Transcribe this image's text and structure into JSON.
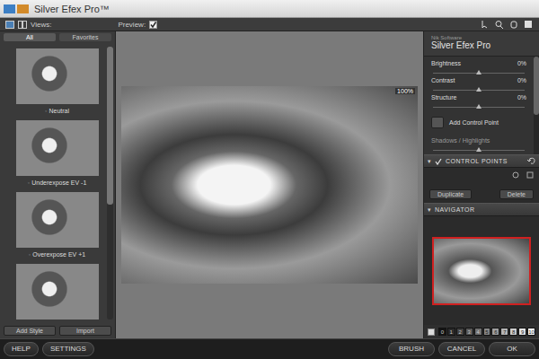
{
  "window": {
    "title": "Silver Efex Pro™"
  },
  "toolbar": {
    "views_label": "Views:",
    "preview_label": "Preview:",
    "preview_checked": true
  },
  "styles_panel": {
    "tabs": [
      {
        "label": "All",
        "selected": true
      },
      {
        "label": "Favorites",
        "selected": false
      }
    ],
    "styles": [
      {
        "label": "Neutral"
      },
      {
        "label": "Underexpose EV -1"
      },
      {
        "label": "Overexpose EV +1"
      },
      {
        "label": ""
      }
    ],
    "buttons": [
      "Add Style",
      "Import"
    ]
  },
  "preview": {
    "zoom": "100%"
  },
  "adjust_panel": {
    "brand": "Nik Software",
    "product": "Silver Efex Pro",
    "sliders": [
      {
        "name": "Brightness",
        "level": 0.5,
        "reading": "0%"
      },
      {
        "name": "Contrast",
        "level": 0.5,
        "reading": "0%"
      },
      {
        "name": "Structure",
        "level": 0.5,
        "reading": "0%"
      }
    ],
    "add_control_point": "Add Control Point",
    "shadows_highlights": {
      "name": "Shadows / Highlights",
      "level": 0.5
    },
    "control_points": {
      "title": "CONTROL POINTS",
      "buttons": [
        "Duplicate",
        "Delete"
      ]
    },
    "navigator": {
      "title": "NAVIGATOR"
    },
    "zones": [
      "0",
      "1",
      "2",
      "3",
      "4",
      "5",
      "6",
      "7",
      "8",
      "9",
      "10"
    ]
  },
  "bottom_bar": {
    "left": [
      "HELP",
      "SETTINGS"
    ],
    "right": [
      "BRUSH",
      "CANCEL",
      "OK"
    ]
  }
}
